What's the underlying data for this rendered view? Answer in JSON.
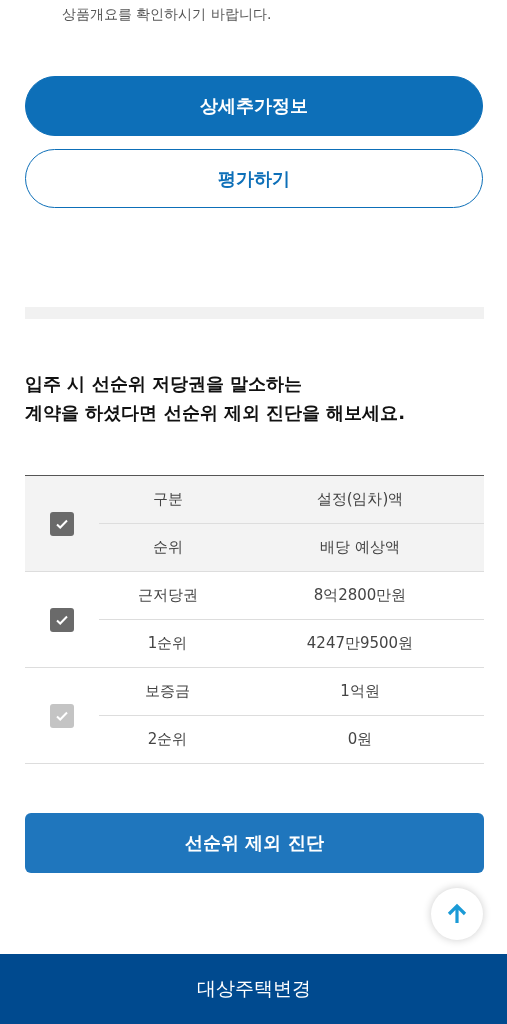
{
  "notice": "상품개요를 확인하시기 바랍니다.",
  "buttons": [
    {
      "label": "상세추가정보",
      "kind": "filled"
    },
    {
      "label": "평가하기",
      "kind": "outline"
    }
  ],
  "heading": [
    "입주 시 선순위 저당권을 말소하는",
    "계약을 하셨다면 선순위 제외 진단을 해보세요."
  ],
  "table": {
    "header": {
      "checked": true,
      "disabled": false,
      "cells": [
        [
          "구분",
          "설정(임차)액"
        ],
        [
          "순위",
          "배당 예상액"
        ]
      ]
    },
    "rows": [
      {
        "checked": true,
        "disabled": false,
        "cells": [
          [
            "근저당권",
            "8억2800만원"
          ],
          [
            "1순위",
            "4247만9500원"
          ]
        ]
      },
      {
        "checked": true,
        "disabled": true,
        "cells": [
          [
            "보증금",
            "1억원"
          ],
          [
            "2순위",
            "0원"
          ]
        ]
      }
    ]
  },
  "diagnose_button": "선순위 제외 진단",
  "bottom_bar": "대상주택변경"
}
